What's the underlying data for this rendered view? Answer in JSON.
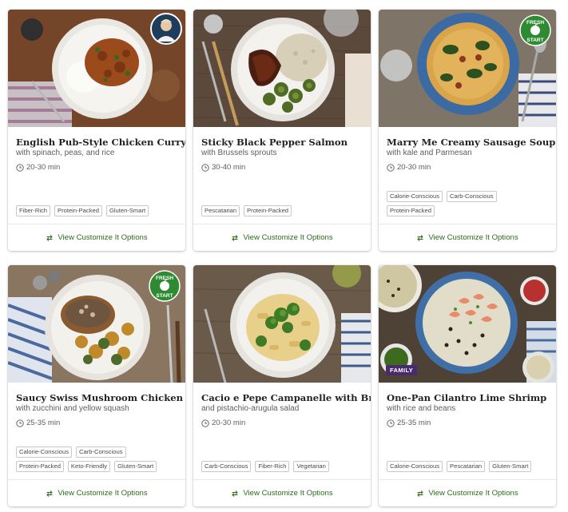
{
  "cta_label": "View Customize It Options",
  "badges": {
    "fresh_line1": "FRESH",
    "fresh_line2": "START",
    "family": "FAMILY"
  },
  "colors": {
    "accent_green": "#2f6a1f",
    "fresh_badge": "#2e8b32",
    "family_badge": "#4a2a6e"
  },
  "recipes": [
    {
      "title": "English Pub-Style Chicken Curry",
      "subtitle": "with spinach, peas, and rice",
      "time": "20-30 min",
      "tags": [
        "Fiber-Rich",
        "Protein-Packed",
        "Gluten-Smart"
      ],
      "badge": "chef-avatar"
    },
    {
      "title": "Sticky Black Pepper Salmon",
      "subtitle": "with Brussels sprouts",
      "time": "30-40 min",
      "tags": [
        "Pescatarian",
        "Protein-Packed"
      ],
      "badge": ""
    },
    {
      "title": "Marry Me Creamy Sausage Soup",
      "subtitle": "with kale and Parmesan",
      "time": "20-30 min",
      "tags": [
        "Calorie-Conscious",
        "Carb-Conscious",
        "Protein-Packed"
      ],
      "badge": "fresh-start"
    },
    {
      "title": "Saucy Swiss Mushroom Chicken",
      "subtitle": "with zucchini and yellow squash",
      "time": "25-35 min",
      "tags": [
        "Calorie-Conscious",
        "Carb-Conscious",
        "Protein-Packed",
        "Keto-Friendly",
        "Gluten-Smart"
      ],
      "badge": "fresh-start"
    },
    {
      "title": "Cacio e Pepe Campanelle with Broccoli",
      "subtitle": "and pistachio-arugula salad",
      "time": "20-30 min",
      "tags": [
        "Carb-Conscious",
        "Fiber-Rich",
        "Vegetarian"
      ],
      "badge": ""
    },
    {
      "title": "One-Pan Cilantro Lime Shrimp",
      "subtitle": "with rice and beans",
      "time": "25-35 min",
      "tags": [
        "Calorie-Conscious",
        "Pescatarian",
        "Gluten-Smart"
      ],
      "badge": "family"
    }
  ]
}
